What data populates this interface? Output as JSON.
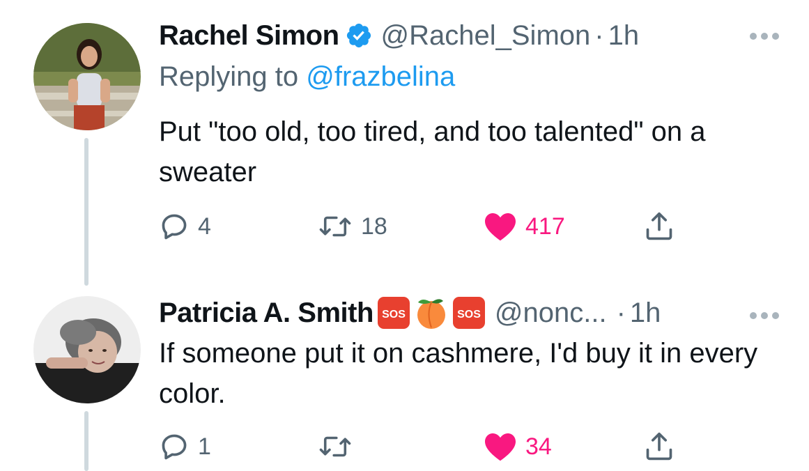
{
  "colors": {
    "text_primary": "#0f1419",
    "text_secondary": "#536471",
    "link": "#1d9bf0",
    "like": "#f91880",
    "verified": "#1d9bf0",
    "thread_line": "#cfd9de"
  },
  "tweets": [
    {
      "author": {
        "name": "Rachel Simon",
        "verified": true,
        "handle": "@Rachel_Simon",
        "avatar_icon": "avatar-photo"
      },
      "separator": "·",
      "time": "1h",
      "replying_to_label": "Replying to",
      "replying_to_handle": "@frazbelina",
      "text": "Put \"too old, too tired, and too talented\" on a sweater",
      "actions": {
        "reply_count": "4",
        "retweet_count": "18",
        "like_count": "417",
        "liked": true
      }
    },
    {
      "author": {
        "name": "Patricia A. Smith",
        "name_emojis": [
          "sos-icon",
          "peach-icon",
          "sos-icon"
        ],
        "emoji_sos_label": "SOS",
        "handle": "@nonc...",
        "avatar_icon": "avatar-photo"
      },
      "separator": "·",
      "time": "1h",
      "text": "If someone put it on cashmere, I'd buy it in every color.",
      "actions": {
        "reply_count": "1",
        "retweet_count": "",
        "like_count": "34",
        "liked": true
      }
    }
  ]
}
